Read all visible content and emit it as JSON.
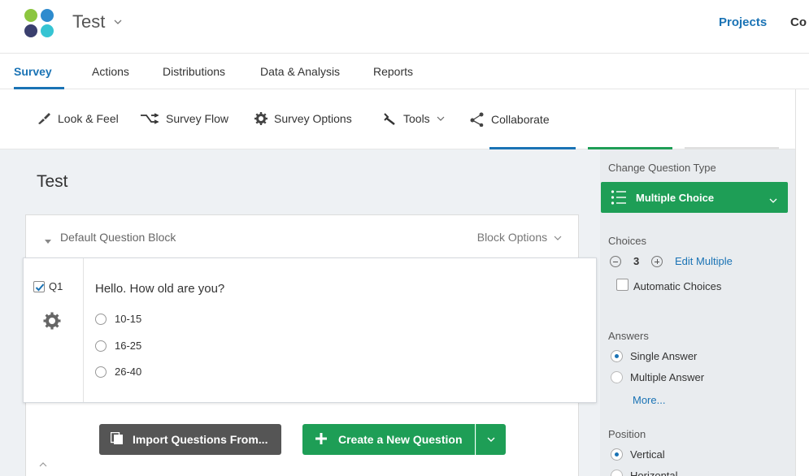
{
  "header": {
    "project_title": "Test",
    "nav_projects": "Projects",
    "nav_cut": "Co"
  },
  "tabs": {
    "items": [
      {
        "label": "Survey",
        "active": true
      },
      {
        "label": "Actions",
        "active": false
      },
      {
        "label": "Distributions",
        "active": false
      },
      {
        "label": "Data & Analysis",
        "active": false
      },
      {
        "label": "Reports",
        "active": false
      }
    ]
  },
  "toolbar": {
    "look_feel": "Look & Feel",
    "survey_flow": "Survey Flow",
    "survey_options": "Survey Options",
    "tools": "Tools",
    "collaborate": "Collaborate"
  },
  "survey": {
    "title": "Test",
    "block": {
      "name": "Default Question Block",
      "options": "Block Options"
    },
    "question": {
      "number": "Q1",
      "text": "Hello. How old are you?",
      "choices": [
        "10-15",
        "16-25",
        "26-40"
      ],
      "selected": true
    },
    "import_button": "Import Questions From...",
    "create_button": "Create a New Question"
  },
  "panel": {
    "change_type_label": "Change Question Type",
    "question_type": "Multiple Choice",
    "choices_label": "Choices",
    "choice_count": "3",
    "edit_multiple": "Edit Multiple",
    "automatic_choices": "Automatic Choices",
    "answers_label": "Answers",
    "single_answer": "Single Answer",
    "multiple_answer": "Multiple Answer",
    "more": "More...",
    "position_label": "Position",
    "vertical": "Vertical",
    "horizontal": "Horizontal"
  },
  "colors": {
    "accent_blue": "#1a73b5",
    "green": "#1e9e56",
    "import_gray": "#555555"
  }
}
